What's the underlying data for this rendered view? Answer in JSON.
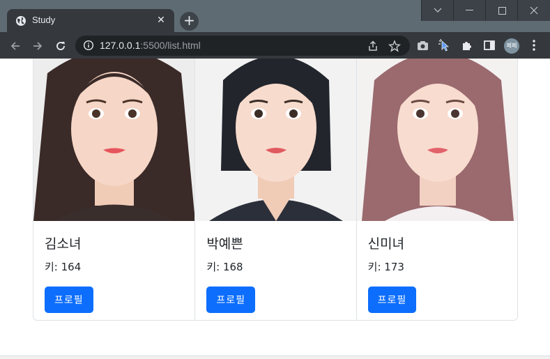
{
  "browser": {
    "tab_title": "Study",
    "url_host": "127.0.0.1",
    "url_rest": ":5500/list.html",
    "profile_initials": "페페"
  },
  "cards": [
    {
      "name": "김소녀",
      "height": "키: 164",
      "button": "프로필",
      "hair": "#3a2a28",
      "top": "#3a2e2c"
    },
    {
      "name": "박예쁜",
      "height": "키: 168",
      "button": "프로필",
      "hair": "#22252c",
      "top": "#2b2f3a"
    },
    {
      "name": "신미녀",
      "height": "키: 173",
      "button": "프로필",
      "hair": "#9a6a6e",
      "top": "#f4f0f2"
    }
  ],
  "colors": {
    "primary": "#0d6efd",
    "border": "#dee2e6"
  }
}
